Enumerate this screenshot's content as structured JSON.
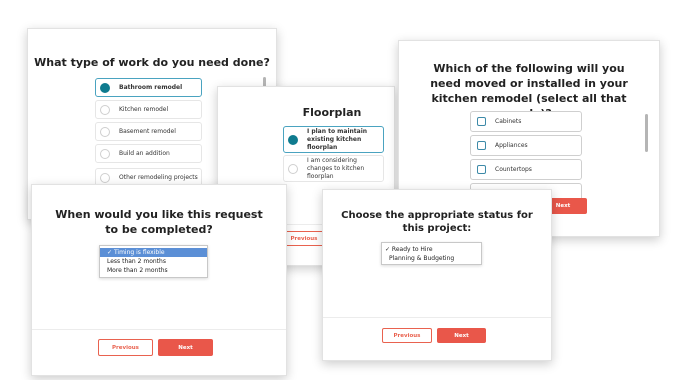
{
  "card_work": {
    "title": "What type of work do you need done?",
    "options": [
      {
        "label": "Bathroom remodel",
        "selected": true
      },
      {
        "label": "Kitchen remodel",
        "selected": false
      },
      {
        "label": "Basement remodel",
        "selected": false
      },
      {
        "label": "Build an addition",
        "selected": false
      },
      {
        "label": "Other remodeling projects",
        "selected": false
      }
    ]
  },
  "card_floorplan": {
    "title": "Floorplan",
    "options": [
      {
        "label": "I plan to maintain existing kitchen floorplan",
        "selected": true
      },
      {
        "label": "I am considering changes to kitchen floorplan",
        "selected": false
      }
    ],
    "previous_label": "Previous"
  },
  "card_kitchen": {
    "title": "Which of the following will you need moved or installed in your kitchen remodel (select all that apply)?",
    "options": [
      {
        "label": "Cabinets"
      },
      {
        "label": "Appliances"
      },
      {
        "label": "Countertops"
      }
    ],
    "next_label": "Next"
  },
  "card_timing": {
    "title": "When would you like this request to be completed?",
    "dropdown_options": [
      "Timing is flexible",
      "Less than 2 months",
      "More than 2 months"
    ],
    "dropdown_highlighted": "Timing is flexible",
    "previous_label": "Previous",
    "next_label": "Next"
  },
  "card_status": {
    "title": "Choose the appropriate status for this project:",
    "dropdown_options": [
      "✓ Ready to Hire",
      "Planning & Budgeting"
    ],
    "previous_label": "Previous",
    "next_label": "Next"
  },
  "colors": {
    "accent": "#e9574a",
    "radio_selected": "#0f7b8f",
    "checkbox_border": "#3d8aa8",
    "dropdown_highlight": "#5b8fd6"
  }
}
